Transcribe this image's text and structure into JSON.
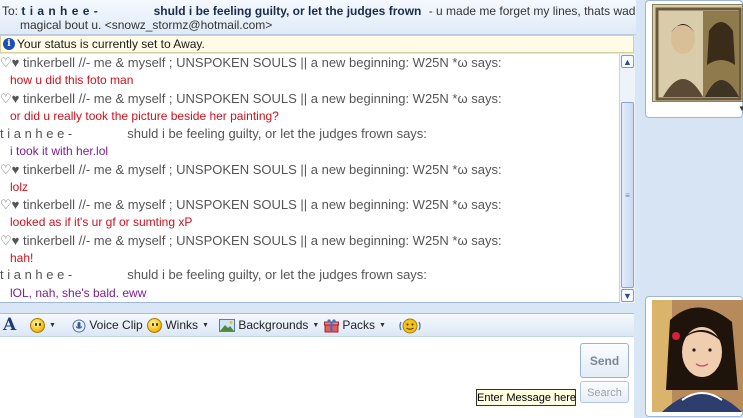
{
  "header": {
    "to_label": "To:",
    "contact_nick": "t i a n h e e -",
    "contact_psm": "shuld i be feeling guilty, or let the judges frown",
    "contact_psm_tail": "- u made me forget my lines, thats wad",
    "contact_line2": "magical bout u. <snowz_stormz@hotmail.com>"
  },
  "status_bar": {
    "text": "Your status is currently set to Away."
  },
  "conversation": {
    "tinkerbell_sender": "♡♥ tinkerbell //- me & myself ; UNSPOKEN SOULS || a new beginning: W25N *ω says:",
    "tianhee_sender_nick": "t i a n h e e -",
    "tianhee_sender_psm": "shuld i be feeling guilty, or let the judges frown says:",
    "messages": [
      "how u did this foto man",
      "or did u really took the picture beside her painting?",
      "i took it with her.lol",
      "lolz",
      "looked as if it's ur gf or sumting xP",
      "hah!",
      "lOL, nah, she's bald. eww"
    ]
  },
  "toolbar": {
    "font_label": "A",
    "voice_clip": "Voice Clip",
    "winks": "Winks",
    "backgrounds": "Backgrounds",
    "packs": "Packs"
  },
  "input": {
    "send_label": "Send",
    "search_label": "Search",
    "tooltip": "Enter Message here"
  },
  "colors": {
    "tinkerbell_text": "#d0101c",
    "tianhee_text": "#7d1e92",
    "accent": "#1c4fb8"
  }
}
